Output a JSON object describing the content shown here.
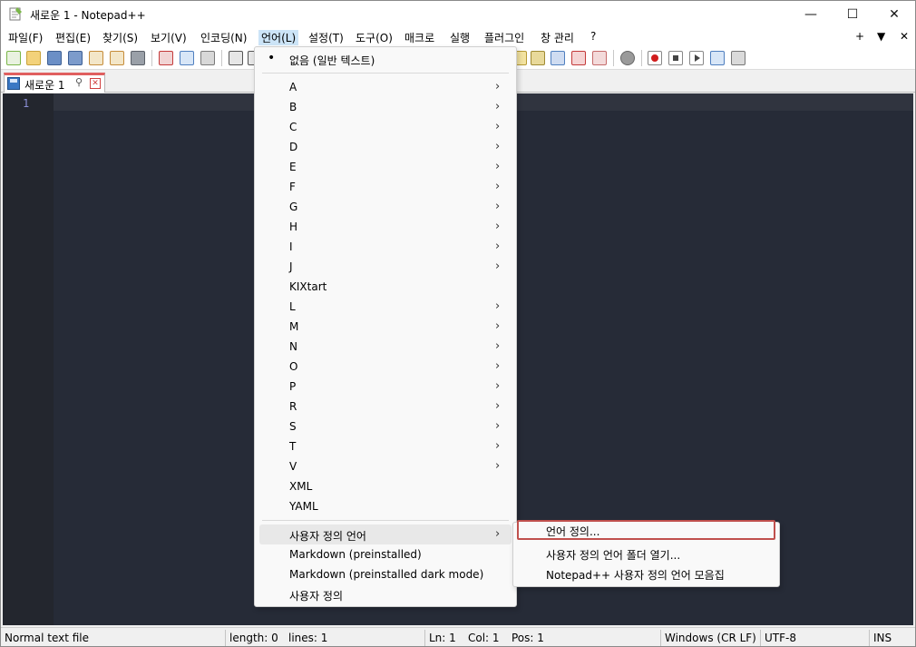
{
  "window": {
    "title": "새로운 1 - Notepad++",
    "minimize": "—",
    "maximize": "☐",
    "close": "✕"
  },
  "menubar": {
    "items": [
      "파일(F)",
      "편집(E)",
      "찾기(S)",
      "보기(V)",
      "인코딩(N)",
      "언어(L)",
      "설정(T)",
      "도구(O)",
      "매크로",
      "실행",
      "플러그인",
      "창 관리",
      "?"
    ],
    "active_index": 5,
    "right": [
      "+",
      "▼",
      "✕"
    ]
  },
  "tab": {
    "label": "새로운 1",
    "pin": "⚲",
    "close": "✕"
  },
  "editor": {
    "line_number": "1"
  },
  "language_menu": {
    "none_item": "없음 (일반 텍스트)",
    "letters": [
      "A",
      "B",
      "C",
      "D",
      "E",
      "F",
      "G",
      "H",
      "I",
      "J"
    ],
    "kixtart": "KIXtart",
    "letters2": [
      "L",
      "M",
      "N",
      "O",
      "P",
      "R",
      "S",
      "T",
      "V"
    ],
    "xml": "XML",
    "yaml": "YAML",
    "user_defined": "사용자 정의 언어",
    "markdown": "Markdown (preinstalled)",
    "markdown_dark": "Markdown (preinstalled dark mode)",
    "user_defined_item": "사용자 정의",
    "arrow": "›",
    "bullet": "•"
  },
  "submenu": {
    "items": [
      "언어 정의...",
      "사용자 정의 언어 폴더 열기...",
      "Notepad++ 사용자 정의 언어 모음집"
    ]
  },
  "statusbar": {
    "file_type": "Normal text file",
    "length": "length: 0",
    "lines": "lines: 1",
    "ln": "Ln: 1",
    "col": "Col: 1",
    "pos": "Pos: 1",
    "eol": "Windows (CR LF)",
    "encoding": "UTF-8",
    "mode": "INS"
  },
  "colors": {
    "editor_bg": "#262b37",
    "tab_accent": "#e05f5f",
    "highlight_border": "#c0504d"
  },
  "toolbar": {
    "icons": [
      "new-file-icon",
      "open-file-icon",
      "save-icon",
      "save-all-icon",
      "close-icon",
      "close-all-icon",
      "print-icon",
      "cut-icon",
      "copy-icon",
      "paste-icon",
      "undo-icon",
      "redo-icon",
      "show-symbol-icon",
      "indent-guide-icon",
      "document-map-icon",
      "function-list-icon",
      "folder-workspace-icon",
      "monitor-icon",
      "record-macro-icon",
      "stop-macro-icon",
      "play-macro-icon",
      "run-macro-multiple-icon",
      "save-macro-icon"
    ]
  }
}
